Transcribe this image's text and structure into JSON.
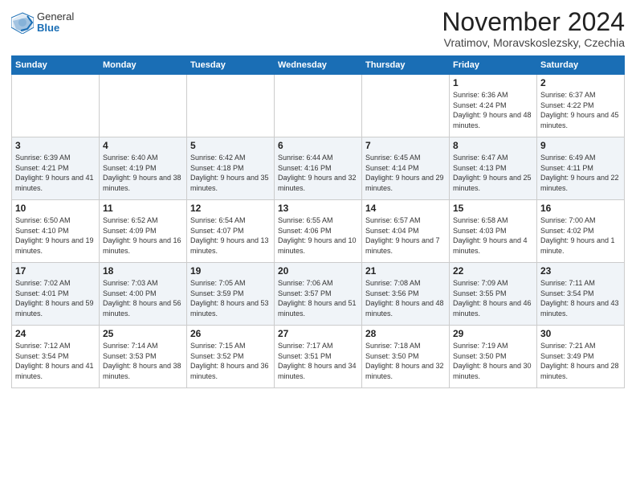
{
  "header": {
    "logo": {
      "general": "General",
      "blue": "Blue"
    },
    "title": "November 2024",
    "location": "Vratimov, Moravskoslezsky, Czechia"
  },
  "calendar": {
    "weekdays": [
      "Sunday",
      "Monday",
      "Tuesday",
      "Wednesday",
      "Thursday",
      "Friday",
      "Saturday"
    ],
    "weeks": [
      [
        {
          "day": "",
          "info": ""
        },
        {
          "day": "",
          "info": ""
        },
        {
          "day": "",
          "info": ""
        },
        {
          "day": "",
          "info": ""
        },
        {
          "day": "",
          "info": ""
        },
        {
          "day": "1",
          "info": "Sunrise: 6:36 AM\nSunset: 4:24 PM\nDaylight: 9 hours\nand 48 minutes."
        },
        {
          "day": "2",
          "info": "Sunrise: 6:37 AM\nSunset: 4:22 PM\nDaylight: 9 hours\nand 45 minutes."
        }
      ],
      [
        {
          "day": "3",
          "info": "Sunrise: 6:39 AM\nSunset: 4:21 PM\nDaylight: 9 hours\nand 41 minutes."
        },
        {
          "day": "4",
          "info": "Sunrise: 6:40 AM\nSunset: 4:19 PM\nDaylight: 9 hours\nand 38 minutes."
        },
        {
          "day": "5",
          "info": "Sunrise: 6:42 AM\nSunset: 4:18 PM\nDaylight: 9 hours\nand 35 minutes."
        },
        {
          "day": "6",
          "info": "Sunrise: 6:44 AM\nSunset: 4:16 PM\nDaylight: 9 hours\nand 32 minutes."
        },
        {
          "day": "7",
          "info": "Sunrise: 6:45 AM\nSunset: 4:14 PM\nDaylight: 9 hours\nand 29 minutes."
        },
        {
          "day": "8",
          "info": "Sunrise: 6:47 AM\nSunset: 4:13 PM\nDaylight: 9 hours\nand 25 minutes."
        },
        {
          "day": "9",
          "info": "Sunrise: 6:49 AM\nSunset: 4:11 PM\nDaylight: 9 hours\nand 22 minutes."
        }
      ],
      [
        {
          "day": "10",
          "info": "Sunrise: 6:50 AM\nSunset: 4:10 PM\nDaylight: 9 hours\nand 19 minutes."
        },
        {
          "day": "11",
          "info": "Sunrise: 6:52 AM\nSunset: 4:09 PM\nDaylight: 9 hours\nand 16 minutes."
        },
        {
          "day": "12",
          "info": "Sunrise: 6:54 AM\nSunset: 4:07 PM\nDaylight: 9 hours\nand 13 minutes."
        },
        {
          "day": "13",
          "info": "Sunrise: 6:55 AM\nSunset: 4:06 PM\nDaylight: 9 hours\nand 10 minutes."
        },
        {
          "day": "14",
          "info": "Sunrise: 6:57 AM\nSunset: 4:04 PM\nDaylight: 9 hours\nand 7 minutes."
        },
        {
          "day": "15",
          "info": "Sunrise: 6:58 AM\nSunset: 4:03 PM\nDaylight: 9 hours\nand 4 minutes."
        },
        {
          "day": "16",
          "info": "Sunrise: 7:00 AM\nSunset: 4:02 PM\nDaylight: 9 hours\nand 1 minute."
        }
      ],
      [
        {
          "day": "17",
          "info": "Sunrise: 7:02 AM\nSunset: 4:01 PM\nDaylight: 8 hours\nand 59 minutes."
        },
        {
          "day": "18",
          "info": "Sunrise: 7:03 AM\nSunset: 4:00 PM\nDaylight: 8 hours\nand 56 minutes."
        },
        {
          "day": "19",
          "info": "Sunrise: 7:05 AM\nSunset: 3:59 PM\nDaylight: 8 hours\nand 53 minutes."
        },
        {
          "day": "20",
          "info": "Sunrise: 7:06 AM\nSunset: 3:57 PM\nDaylight: 8 hours\nand 51 minutes."
        },
        {
          "day": "21",
          "info": "Sunrise: 7:08 AM\nSunset: 3:56 PM\nDaylight: 8 hours\nand 48 minutes."
        },
        {
          "day": "22",
          "info": "Sunrise: 7:09 AM\nSunset: 3:55 PM\nDaylight: 8 hours\nand 46 minutes."
        },
        {
          "day": "23",
          "info": "Sunrise: 7:11 AM\nSunset: 3:54 PM\nDaylight: 8 hours\nand 43 minutes."
        }
      ],
      [
        {
          "day": "24",
          "info": "Sunrise: 7:12 AM\nSunset: 3:54 PM\nDaylight: 8 hours\nand 41 minutes."
        },
        {
          "day": "25",
          "info": "Sunrise: 7:14 AM\nSunset: 3:53 PM\nDaylight: 8 hours\nand 38 minutes."
        },
        {
          "day": "26",
          "info": "Sunrise: 7:15 AM\nSunset: 3:52 PM\nDaylight: 8 hours\nand 36 minutes."
        },
        {
          "day": "27",
          "info": "Sunrise: 7:17 AM\nSunset: 3:51 PM\nDaylight: 8 hours\nand 34 minutes."
        },
        {
          "day": "28",
          "info": "Sunrise: 7:18 AM\nSunset: 3:50 PM\nDaylight: 8 hours\nand 32 minutes."
        },
        {
          "day": "29",
          "info": "Sunrise: 7:19 AM\nSunset: 3:50 PM\nDaylight: 8 hours\nand 30 minutes."
        },
        {
          "day": "30",
          "info": "Sunrise: 7:21 AM\nSunset: 3:49 PM\nDaylight: 8 hours\nand 28 minutes."
        }
      ]
    ]
  }
}
